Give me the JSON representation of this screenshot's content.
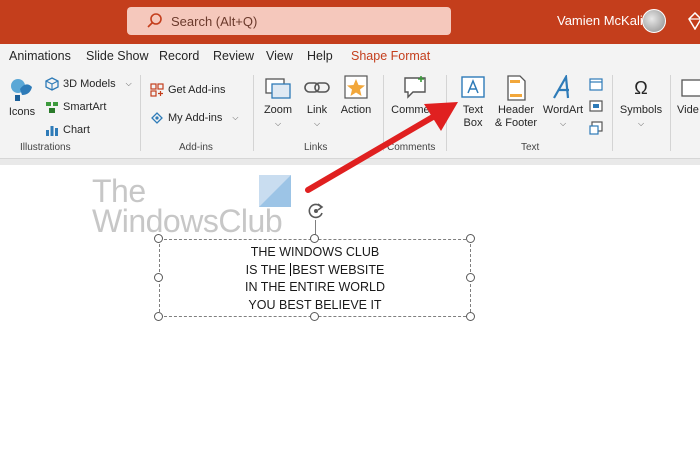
{
  "titlebar": {
    "search_placeholder": "Search (Alt+Q)",
    "user_name": "Vamien McKalin",
    "accent_color": "#c43e1c"
  },
  "tabs": [
    "Animations",
    "Slide Show",
    "Record",
    "Review",
    "View",
    "Help",
    "Shape Format"
  ],
  "active_tab": "Shape Format",
  "ribbon": {
    "illustrations": {
      "label": "Illustrations",
      "icons_label": "Icons",
      "models_label": "3D Models",
      "smartart_label": "SmartArt",
      "chart_label": "Chart"
    },
    "addins": {
      "label": "Add-ins",
      "get_label": "Get Add-ins",
      "my_label": "My Add-ins"
    },
    "links": {
      "label": "Links",
      "zoom_label": "Zoom",
      "link_label": "Link",
      "action_label": "Action"
    },
    "comments": {
      "label": "Comments",
      "comment_label": "Comment"
    },
    "text": {
      "label": "Text",
      "textbox_line1": "Text",
      "textbox_line2": "Box",
      "header_line1": "Header",
      "header_line2": "& Footer",
      "wordart_label": "WordArt"
    },
    "symbols": {
      "symbols_label": "Symbols",
      "video_label": "Vide"
    }
  },
  "watermark": {
    "line1": "The",
    "line2": "WindowsClub"
  },
  "textbox": {
    "line1": "THE WINDOWS CLUB",
    "line2a": "IS THE",
    "line2b": "BEST WEBSITE",
    "line3": "IN THE ENTIRE WORLD",
    "line4": "YOU BEST BELIEVE IT"
  },
  "annotation_color": "#e02020"
}
